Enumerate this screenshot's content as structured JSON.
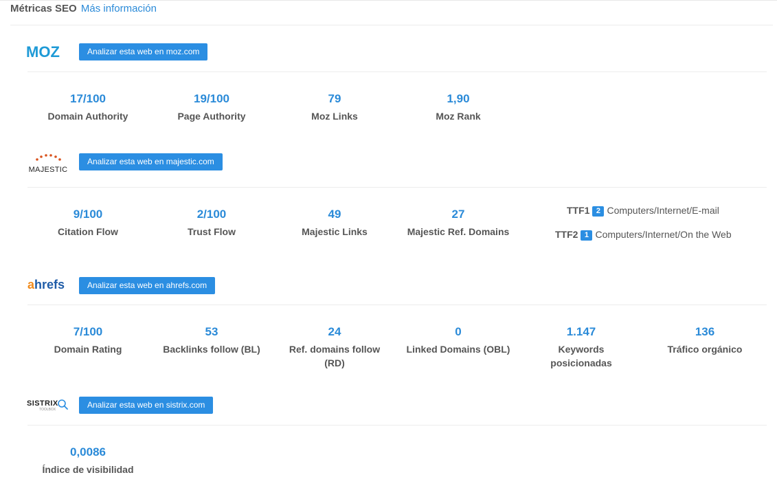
{
  "header": {
    "title": "Métricas SEO",
    "more_link": "Más información"
  },
  "moz": {
    "logo_text": "MOZ",
    "button": "Analizar esta web en moz.com",
    "metrics": [
      {
        "value": "17/100",
        "label": "Domain Authority"
      },
      {
        "value": "19/100",
        "label": "Page Authority"
      },
      {
        "value": "79",
        "label": "Moz Links"
      },
      {
        "value": "1,90",
        "label": "Moz Rank"
      }
    ]
  },
  "majestic": {
    "logo_text": "MAJESTIC",
    "button": "Analizar esta web en majestic.com",
    "metrics": [
      {
        "value": "9/100",
        "label": "Citation Flow"
      },
      {
        "value": "2/100",
        "label": "Trust Flow"
      },
      {
        "value": "49",
        "label": "Majestic Links"
      },
      {
        "value": "27",
        "label": "Majestic Ref. Domains"
      }
    ],
    "ttf": [
      {
        "key": "TTF1",
        "badge": "2",
        "topic": "Computers/Internet/E-mail"
      },
      {
        "key": "TTF2",
        "badge": "1",
        "topic": "Computers/Internet/On the Web"
      }
    ]
  },
  "ahrefs": {
    "logo_text_a": "a",
    "logo_text_rest": "hrefs",
    "button": "Analizar esta web en ahrefs.com",
    "metrics": [
      {
        "value": "7/100",
        "label": "Domain Rating"
      },
      {
        "value": "53",
        "label": "Backlinks follow (BL)"
      },
      {
        "value": "24",
        "label": "Ref. domains follow (RD)"
      },
      {
        "value": "0",
        "label": "Linked Domains (OBL)"
      },
      {
        "value": "1.147",
        "label": "Keywords posicionadas"
      },
      {
        "value": "136",
        "label": "Tráfico orgánico"
      }
    ]
  },
  "sistrix": {
    "logo_text": "SISTRIX",
    "logo_sub": "TOOLBOX",
    "button": "Analizar esta web en sistrix.com",
    "metrics": [
      {
        "value": "0,0086",
        "label": "Índice de visibilidad"
      }
    ]
  },
  "colors": {
    "accent": "#2b8ee2",
    "value_text": "#2a8ad8",
    "label_text": "#555555"
  }
}
